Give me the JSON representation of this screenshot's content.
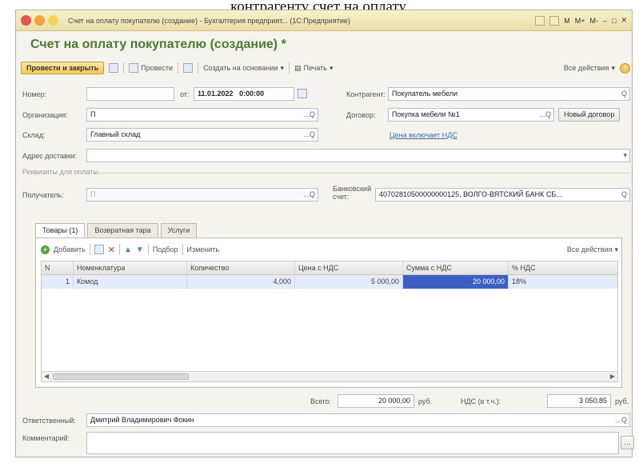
{
  "caption": "контрагенту счет на оплату.",
  "window": {
    "title": "Счет на оплату покупателю (создание) - Бухгалтерия предприят... (1С:Предприятие)",
    "controls": [
      "M",
      "M+",
      "M-"
    ]
  },
  "doc_title": "Счет на оплату покупателю (создание) *",
  "toolbar": {
    "post_close": "Провести и закрыть",
    "post": "Провести",
    "create_based": "Создать на основании",
    "print": "Печать",
    "all_actions": "Все действия"
  },
  "form": {
    "number_label": "Номер:",
    "number_value": "",
    "date_prefix": "от:",
    "date_value": "11.01.2022",
    "time_value": "0:00:00",
    "counterparty_label": "Контрагент:",
    "counterparty_value": "Покупатель мебели",
    "org_label": "Организация:",
    "org_value": "П",
    "contract_label": "Договор:",
    "contract_value": "Покупка мебели №1",
    "new_contract": "Новый договор",
    "warehouse_label": "Склад:",
    "warehouse_value": "Главный склад",
    "vat_link": "Цена включает НДС",
    "address_label": "Адрес доставки:",
    "address_value": "",
    "payment_section": "Реквизиты для оплаты",
    "recipient_label": "Получатель:",
    "recipient_value": "П",
    "bank_label": "Банковский счет:",
    "bank_value": "40702810500000000125, ВОЛГО-ВЯТСКИЙ БАНК СБ..."
  },
  "tabs": [
    "Товары (1)",
    "Возвратная тара",
    "Услуги"
  ],
  "table_toolbar": {
    "add": "Добавить",
    "pick": "Подбор",
    "change": "Изменить",
    "all_actions": "Все действия"
  },
  "table": {
    "headers": [
      "N",
      "Номенклатура",
      "Количество",
      "Цена с НДС",
      "Сумма с НДС",
      "% НДС"
    ],
    "rows": [
      [
        "1",
        "Комод",
        "4,000",
        "5 000,00",
        "20 000,00",
        "18%"
      ]
    ]
  },
  "totals": {
    "total_label": "Всего:",
    "total_value": "20 000,00",
    "currency": "руб.",
    "vat_label": "НДС (в т.ч.):",
    "vat_value": "3 050,85",
    "currency2": "руб."
  },
  "bottom": {
    "responsible_label": "Ответственный:",
    "responsible_value": "Дмитрий Владимирович Фокин",
    "comment_label": "Комментарий:",
    "comment_value": ""
  },
  "colors": {
    "accent_green": "#4b7a30",
    "post_button": "#f3c858",
    "selection": "#3d5fc4"
  }
}
